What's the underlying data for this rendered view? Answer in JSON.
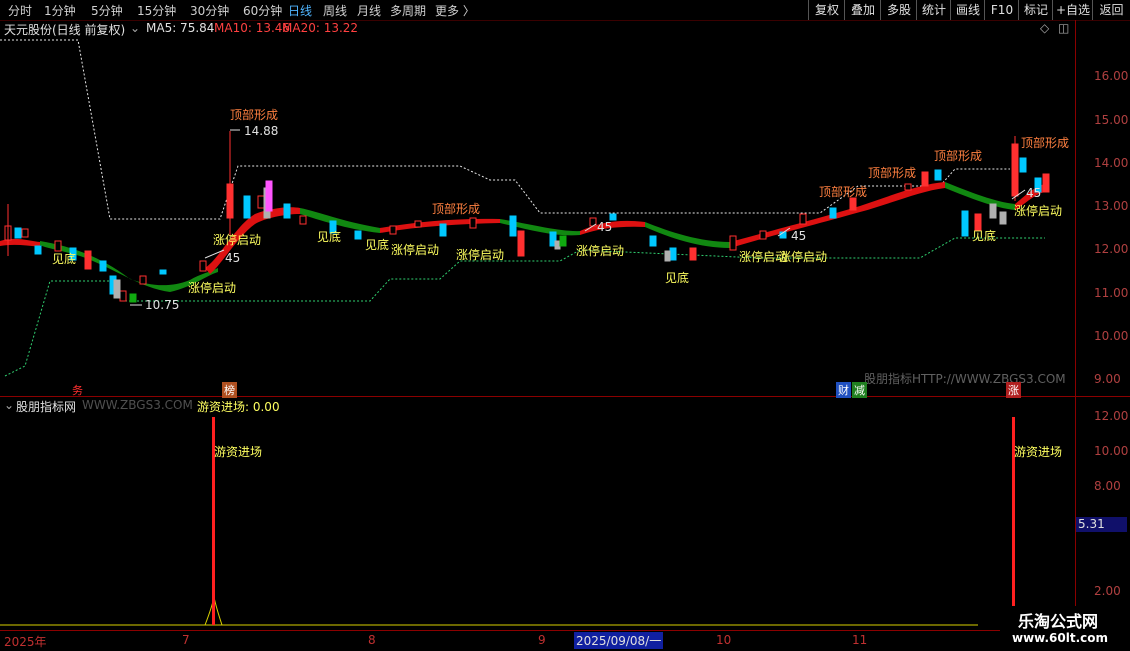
{
  "toolbar": {
    "periods": [
      "分时",
      "1分钟",
      "5分钟",
      "15分钟",
      "30分钟",
      "60分钟",
      "日线",
      "周线",
      "月线",
      "多周期",
      "更多 〉"
    ],
    "active_period": "日线",
    "right_buttons": [
      "复权",
      "叠加",
      "多股",
      "统计",
      "画线",
      "F10",
      "标记",
      "+自选",
      "返回"
    ]
  },
  "main": {
    "title": "天元股份(日线 前复权)",
    "ma5": "MA5: 75.84",
    "ma10": "MA10: 13.46",
    "ma20": "MA20: 13.22",
    "price_ticks": [
      "16.00",
      "15.00",
      "14.00",
      "13.00",
      "12.00",
      "11.00",
      "10.00",
      "9.00"
    ],
    "labels": {
      "top1": "顶部形成",
      "top2": "顶部形成",
      "top3": "顶部形成",
      "top4": "顶部形成",
      "top5": "顶部形成",
      "top6": "顶部形成",
      "bottom1": "见底",
      "bottom2": "见底",
      "bottom3": "见底",
      "bottom4": "见底",
      "bottom5": "见底",
      "zt1": "涨停启动",
      "zt2": "涨停启动",
      "zt3": "涨停启动",
      "zt4": "涨停启动",
      "zt5": "涨停启动",
      "zt6": "涨停启动",
      "zt7": "涨停启动",
      "zt8": "涨停启动",
      "n45a": "45",
      "n45b": "45",
      "n45c": "45",
      "n45d": "45",
      "high": "14.88",
      "low": "10.75",
      "watermark": "股朋指标HTTP://WWW.ZBGS3.COM"
    },
    "badges": {
      "b1": "务",
      "b2": "榜",
      "b3": "财",
      "b4": "减",
      "b5": "涨"
    }
  },
  "sub": {
    "title": "股朋指标网",
    "watermark": "WWW.ZBGS3.COM -",
    "value": "游资进场: 0.00",
    "ticks": [
      "12.00",
      "10.00",
      "8.00",
      "6.00",
      "4.00",
      "2.00"
    ],
    "marker_value": "5.31",
    "label1": "游资进场",
    "label2": "游资进场"
  },
  "dates": {
    "year": "2025年",
    "m7": "7",
    "m8": "8",
    "m9": "9",
    "cursor": "2025/09/08/一",
    "m10": "10",
    "m11": "11"
  },
  "logo": {
    "line1": "乐淘公式网",
    "line2": "www.60lt.com"
  },
  "colors": {
    "up": "#ff3030",
    "down": "#00d0ff",
    "ma_band_up": "#ee1111",
    "ma_band_down": "#119911",
    "axis": "#8b0000"
  }
}
